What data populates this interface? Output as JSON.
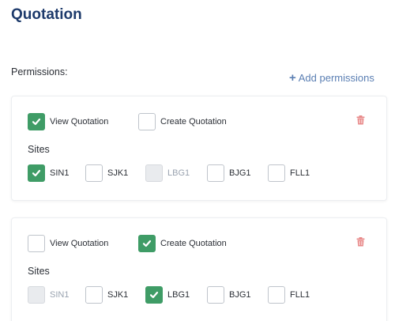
{
  "page": {
    "title": "Quotation"
  },
  "permissions": {
    "label": "Permissions:",
    "add_label": "Add permissions",
    "sites_label": "Sites",
    "groups": [
      {
        "actions": [
          {
            "label": "View Quotation",
            "checked": true
          },
          {
            "label": "Create Quotation",
            "checked": false
          }
        ],
        "sites": [
          {
            "label": "SIN1",
            "checked": true,
            "disabled": false
          },
          {
            "label": "SJK1",
            "checked": false,
            "disabled": false
          },
          {
            "label": "LBG1",
            "checked": false,
            "disabled": true
          },
          {
            "label": "BJG1",
            "checked": false,
            "disabled": false
          },
          {
            "label": "FLL1",
            "checked": false,
            "disabled": false
          }
        ]
      },
      {
        "actions": [
          {
            "label": "View Quotation",
            "checked": false
          },
          {
            "label": "Create Quotation",
            "checked": true
          }
        ],
        "sites": [
          {
            "label": "SIN1",
            "checked": false,
            "disabled": true
          },
          {
            "label": "SJK1",
            "checked": false,
            "disabled": false
          },
          {
            "label": "LBG1",
            "checked": true,
            "disabled": false
          },
          {
            "label": "BJG1",
            "checked": false,
            "disabled": false
          },
          {
            "label": "FLL1",
            "checked": false,
            "disabled": false
          }
        ]
      }
    ]
  },
  "colors": {
    "accent": "#3f9c66",
    "title": "#1d3a6b",
    "link": "#5b7fb3",
    "delete": "#e88a8a"
  },
  "icons": {
    "check": "check-icon",
    "add": "plus-icon",
    "delete": "trash-icon"
  }
}
